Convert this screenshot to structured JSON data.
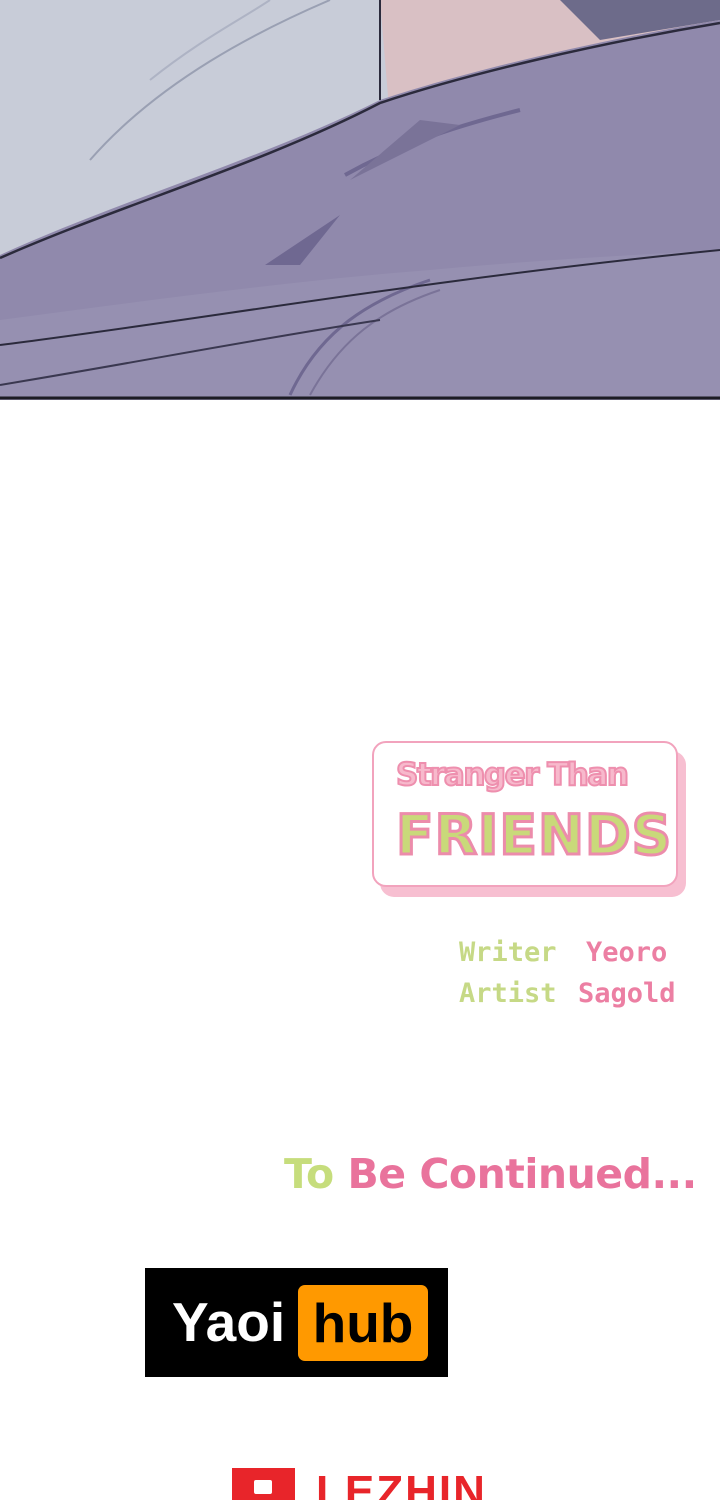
{
  "colors": {
    "panel_light": "#c8ccd8",
    "panel_purple": "#9089ac",
    "panel_dark": "#6f6891",
    "logo_pink": "#f2a3bd",
    "logo_green": "#c9d97a",
    "credit_green": "#c6d986",
    "credit_pink": "#ec7fa3",
    "watermark_orange": "#ff9900",
    "lezhin_red": "#e8252a"
  },
  "logo": {
    "subtitle": "Stranger Than",
    "title": "FRIENDS"
  },
  "credits": [
    {
      "role": "Writer",
      "name": "Yeoro"
    },
    {
      "role": "Artist",
      "name": "Sagold"
    }
  ],
  "ending": {
    "part1": "To",
    "part2": "Be Continued..."
  },
  "watermark": {
    "left": "Yaoi",
    "right": "hub"
  },
  "publisher": {
    "name": "LEZHIN"
  }
}
